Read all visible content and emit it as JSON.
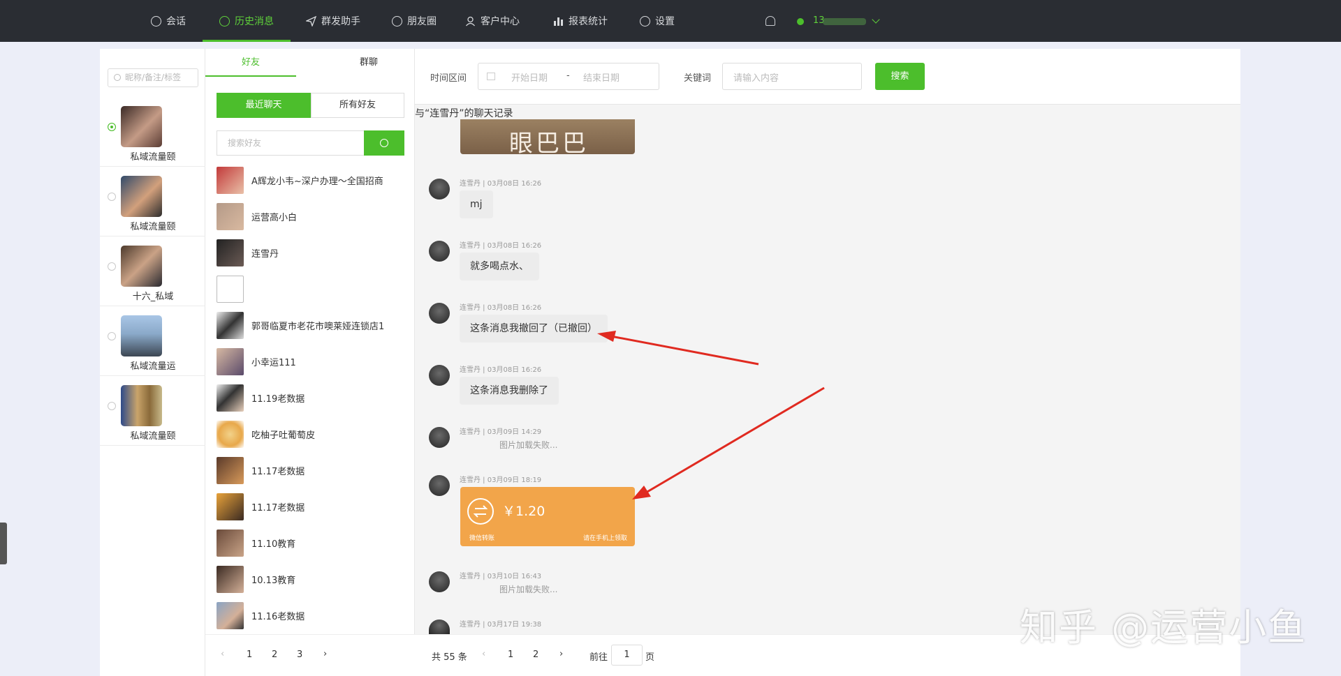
{
  "nav": {
    "items": [
      {
        "label": "会话",
        "icon": "chat-icon"
      },
      {
        "label": "历史消息",
        "icon": "clock-icon",
        "active": true
      },
      {
        "label": "群发助手",
        "icon": "send-icon"
      },
      {
        "label": "朋友圈",
        "icon": "moments-icon"
      },
      {
        "label": "客户中心",
        "icon": "user-icon"
      },
      {
        "label": "报表统计",
        "icon": "chart-icon"
      },
      {
        "label": "设置",
        "icon": "gear-icon"
      }
    ],
    "user_number": "13"
  },
  "accounts": {
    "search_placeholder": "昵称/备注/标签",
    "items": [
      {
        "name": "私域流量颐",
        "selected": true
      },
      {
        "name": "私域流量颐",
        "selected": false
      },
      {
        "name": "十六_私域",
        "selected": false
      },
      {
        "name": "私域流量运",
        "selected": false
      },
      {
        "name": "私域流量颐",
        "selected": false
      }
    ]
  },
  "friends": {
    "tabs": [
      "好友",
      "群聊"
    ],
    "segments": [
      "最近聊天",
      "所有好友"
    ],
    "search_placeholder": "搜索好友",
    "items": [
      {
        "name": "A辉龙小韦~深户办理～全国招商"
      },
      {
        "name": "运营高小白"
      },
      {
        "name": "连雪丹"
      },
      {
        "name": ""
      },
      {
        "name": "郭哥临夏市老花市噢莱娅连锁店1"
      },
      {
        "name": "小幸运111"
      },
      {
        "name": "11.19老数据"
      },
      {
        "name": "吃柚子吐葡萄皮"
      },
      {
        "name": "11.17老数据"
      },
      {
        "name": "11.17老数据"
      },
      {
        "name": "11.10教育"
      },
      {
        "name": "10.13教育"
      },
      {
        "name": "11.16老数据"
      }
    ],
    "pager": {
      "prev": "‹",
      "pages": [
        "1",
        "2",
        "3"
      ],
      "next": "›"
    }
  },
  "filter": {
    "time_label": "时间区间",
    "start_placeholder": "开始日期",
    "dash": "-",
    "end_placeholder": "结束日期",
    "keyword_label": "关键词",
    "keyword_placeholder": "请输入内容",
    "search_button": "搜索"
  },
  "chat": {
    "title": "与“连雪丹”的聊天记录",
    "image_text": "眼巴巴",
    "messages": [
      {
        "meta": "连雪丹 | 03月08日 16:26",
        "text": "mj"
      },
      {
        "meta": "连雪丹 | 03月08日 16:26",
        "text": "就多喝点水、"
      },
      {
        "meta": "连雪丹 | 03月08日 16:26",
        "text": "这条消息我撤回了（已撤回）"
      },
      {
        "meta": "连雪丹 | 03月08日 16:26",
        "text": "这条消息我删除了"
      },
      {
        "meta": "连雪丹 | 03月09日 14:29",
        "text": "图片加载失败..."
      },
      {
        "meta": "连雪丹 | 03月09日 18:19",
        "text": ""
      },
      {
        "meta": "连雪丹 | 03月10日 16:43",
        "text": "图片加载失败..."
      },
      {
        "meta": "连雪丹 | 03月17日 19:38",
        "text": ""
      }
    ],
    "transfer": {
      "amount": "￥1.20",
      "left": "微信转账",
      "right": "请在手机上领取"
    },
    "pager": {
      "total": "共 55 条",
      "prev": "‹",
      "pages": [
        "1",
        "2"
      ],
      "next": "›",
      "goto_label": "前往",
      "goto_value": "1",
      "page_suffix": "页"
    }
  },
  "watermark": "知乎 @运营小鱼",
  "colors": {
    "accent": "#4cbe2c",
    "topbar": "#2a2d33",
    "transfer": "#f2a54a",
    "arrow": "#e02a20"
  }
}
